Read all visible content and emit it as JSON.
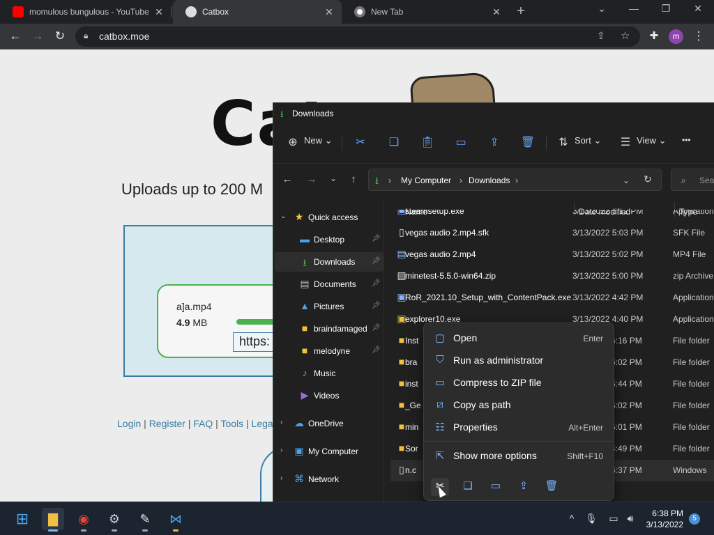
{
  "browser": {
    "tabs": [
      {
        "title": "momulous bungulous - YouTube",
        "favicon": "youtube-icon"
      },
      {
        "title": "Catbox",
        "favicon": "catbox-icon"
      },
      {
        "title": "New Tab",
        "favicon": "chrome-icon"
      }
    ],
    "new_tab_label": "+",
    "url": "catbox.moe",
    "profile_initial": "m"
  },
  "webpage": {
    "logo_text": "Cat",
    "uploads_text": "Uploads up to 200 M",
    "upload_card": {
      "filename": "a]a.mp4",
      "size_value": "4.9",
      "size_unit": "MB",
      "progress_fraction": 1.0,
      "link_text": "https:"
    },
    "footer_links": [
      "Login",
      "Register",
      "FAQ",
      "Tools",
      "Lega"
    ],
    "footer_sep": "|"
  },
  "explorer": {
    "title": "Downloads",
    "commands": {
      "new": "New",
      "sort": "Sort",
      "view": "View",
      "more": "•••"
    },
    "address": {
      "root": "My Computer",
      "folder": "Downloads",
      "sep": "›"
    },
    "search_placeholder": "Sear",
    "nav": [
      {
        "label": "Quick access",
        "icon": "star-icon",
        "level": 0,
        "expanded": true
      },
      {
        "label": "Desktop",
        "icon": "desktop-icon",
        "level": 1,
        "pinned": true
      },
      {
        "label": "Downloads",
        "icon": "download-icon",
        "level": 1,
        "pinned": true,
        "selected": true
      },
      {
        "label": "Documents",
        "icon": "documents-icon",
        "level": 1,
        "pinned": true
      },
      {
        "label": "Pictures",
        "icon": "pictures-icon",
        "level": 1,
        "pinned": true
      },
      {
        "label": "braindamaged",
        "icon": "folder-icon",
        "level": 1,
        "pinned": true
      },
      {
        "label": "melodyne",
        "icon": "folder-icon",
        "level": 1,
        "pinned": true
      },
      {
        "label": "Music",
        "icon": "music-icon",
        "level": 1
      },
      {
        "label": "Videos",
        "icon": "videos-icon",
        "level": 1
      },
      {
        "label": "OneDrive",
        "icon": "cloud-icon",
        "level": 0
      },
      {
        "label": "My Computer",
        "icon": "computer-icon",
        "level": 0
      },
      {
        "label": "Network",
        "icon": "network-icon",
        "level": 0
      }
    ],
    "columns": {
      "name": "Name",
      "date": "Date modified",
      "type": "Type"
    },
    "files": [
      {
        "name": "steamsetup.exe",
        "date": "3/13/2022 5:12 PM",
        "type": "Application",
        "icon": "exe-icon"
      },
      {
        "name": "vegas audio 2.mp4.sfk",
        "date": "3/13/2022 5:03 PM",
        "type": "SFK File",
        "icon": "file-icon"
      },
      {
        "name": "vegas audio 2.mp4",
        "date": "3/13/2022 5:02 PM",
        "type": "MP4 File",
        "icon": "video-file-icon"
      },
      {
        "name": "minetest-5.5.0-win64.zip",
        "date": "3/13/2022 5:00 PM",
        "type": "zip Archive",
        "icon": "zip-icon"
      },
      {
        "name": "RoR_2021.10_Setup_with_ContentPack.exe",
        "date": "3/13/2022 4:42 PM",
        "type": "Application",
        "icon": "exe-icon"
      },
      {
        "name": "explorer10.exe",
        "date": "3/13/2022 4:40 PM",
        "type": "Application",
        "icon": "exe-icon"
      },
      {
        "name": "Inst",
        "date": "6:16 PM",
        "type": "File folder",
        "icon": "folder-icon"
      },
      {
        "name": "bra",
        "date": "6:02 PM",
        "type": "File folder",
        "icon": "folder-icon"
      },
      {
        "name": "inst",
        "date": "5:44 PM",
        "type": "File folder",
        "icon": "folder-icon"
      },
      {
        "name": "_Ge",
        "date": "5:02 PM",
        "type": "File folder",
        "icon": "folder-icon"
      },
      {
        "name": "min",
        "date": "5:01 PM",
        "type": "File folder",
        "icon": "folder-icon"
      },
      {
        "name": "Sor",
        "date": "4:49 PM",
        "type": "File folder",
        "icon": "folder-icon"
      },
      {
        "name": "n.c",
        "date": "6:37 PM",
        "type": "Windows",
        "icon": "file-icon",
        "selected": true
      }
    ]
  },
  "context_menu": {
    "items": [
      {
        "label": "Open",
        "shortcut": "Enter",
        "icon": "open-icon"
      },
      {
        "label": "Run as administrator",
        "shortcut": "",
        "icon": "shield-icon"
      },
      {
        "label": "Compress to ZIP file",
        "shortcut": "",
        "icon": "zip-icon"
      },
      {
        "label": "Copy as path",
        "shortcut": "",
        "icon": "path-icon"
      },
      {
        "label": "Properties",
        "shortcut": "Alt+Enter",
        "icon": "properties-icon"
      }
    ],
    "more": {
      "label": "Show more options",
      "shortcut": "Shift+F10",
      "icon": "more-options-icon"
    },
    "quick_actions": [
      "cut-icon",
      "copy-icon",
      "rename-icon",
      "share-icon",
      "delete-icon"
    ]
  },
  "taskbar": {
    "apps": [
      "start-icon",
      "file-explorer-icon",
      "chrome-icon",
      "steam-icon",
      "paint-icon",
      "vscode-icon"
    ],
    "time": "6:38 PM",
    "date": "3/13/2022",
    "notifications": "5"
  },
  "colors": {
    "accent": "#7ab7ff",
    "download_green": "#3fb950",
    "folder_yellow": "#f0c040"
  }
}
